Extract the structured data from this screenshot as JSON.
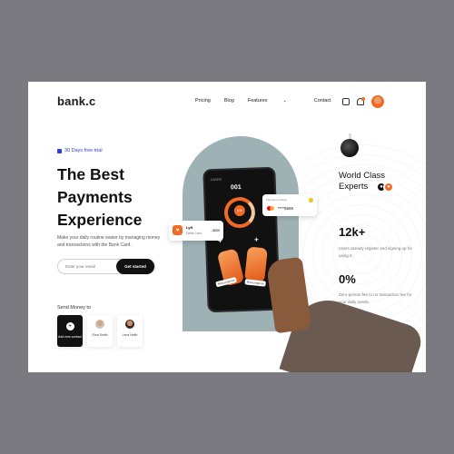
{
  "brand": {
    "logo": "bank.c",
    "accent": "#f36a24",
    "accent_blue": "#2c3ed6",
    "dark": "#111111"
  },
  "nav": {
    "items": [
      {
        "label": "Pricing"
      },
      {
        "label": "Blog"
      },
      {
        "label": "Features",
        "icon": "chevron-down-icon"
      },
      {
        "label": "Contact"
      }
    ]
  },
  "header_icons": [
    "wallet-icon",
    "bell-icon",
    "avatar"
  ],
  "hero": {
    "trial": "30 Days free trial",
    "headline_lines": [
      "The Best",
      "Payments",
      "Experience"
    ],
    "description": "Make your daily routine easier by managing money and transactions with the Bank Card.",
    "email_placeholder": "Enter your email",
    "cta": "Get started"
  },
  "send_money": {
    "label": "Send Money to",
    "tiles": [
      {
        "label": "Add new contact",
        "icon": "plus-icon"
      },
      {
        "label": "Rina Smith"
      },
      {
        "label": "Lena Neith"
      }
    ]
  },
  "phone": {
    "screen_title": "CARDS",
    "number": "001",
    "ring_label": "54k",
    "card_tags": [
      "Mitra progress",
      "Mitra progress"
    ]
  },
  "popup_payment": {
    "name": "Lyft",
    "sub": "Debit Card",
    "amount": "- $555"
  },
  "popup_card": {
    "title": "Payment method",
    "card": "****5555"
  },
  "right": {
    "experts_title": "World Class Experts",
    "stat1_value": "12k+",
    "stat1_desc": "Users already register and signing up for using it.",
    "stat2_value": "0%",
    "stat2_desc": "Zero-person fee to no transaction fee for your daily needs."
  }
}
